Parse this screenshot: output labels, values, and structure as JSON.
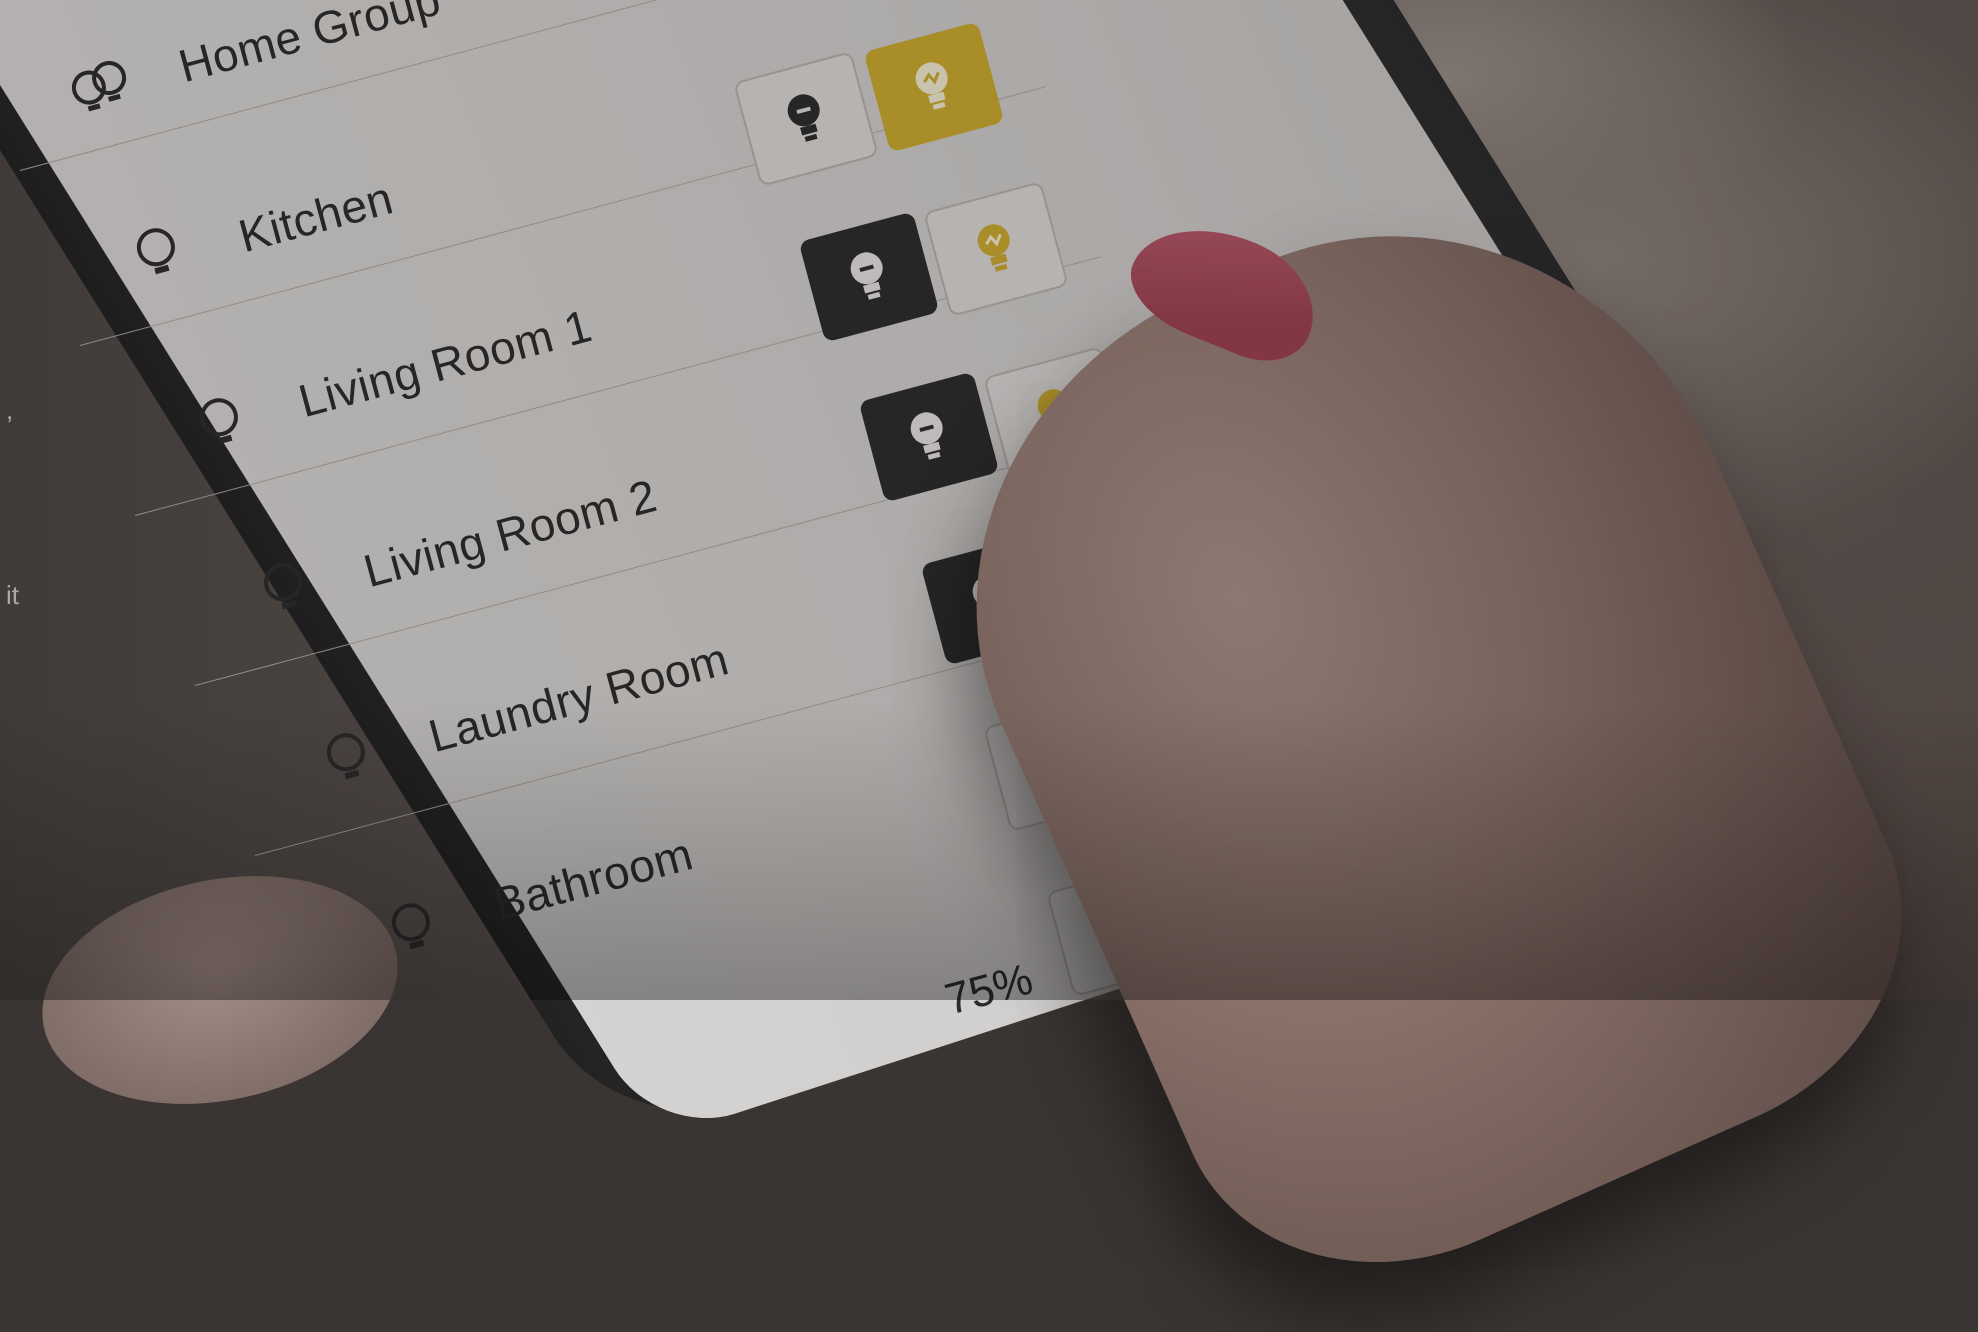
{
  "rooms": [
    {
      "name": "Home Group"
    },
    {
      "name": "Kitchen"
    },
    {
      "name": "Living Room 1"
    },
    {
      "name": "Living Room 2"
    },
    {
      "name": "Laundry Room"
    },
    {
      "name": "Bathroom"
    }
  ],
  "partial_percent": "75%",
  "edge_text": {
    "comma": ",",
    "word": "it"
  },
  "colors": {
    "accent_yellow": "#c9a92f",
    "dark_button": "#2b2b2b"
  }
}
